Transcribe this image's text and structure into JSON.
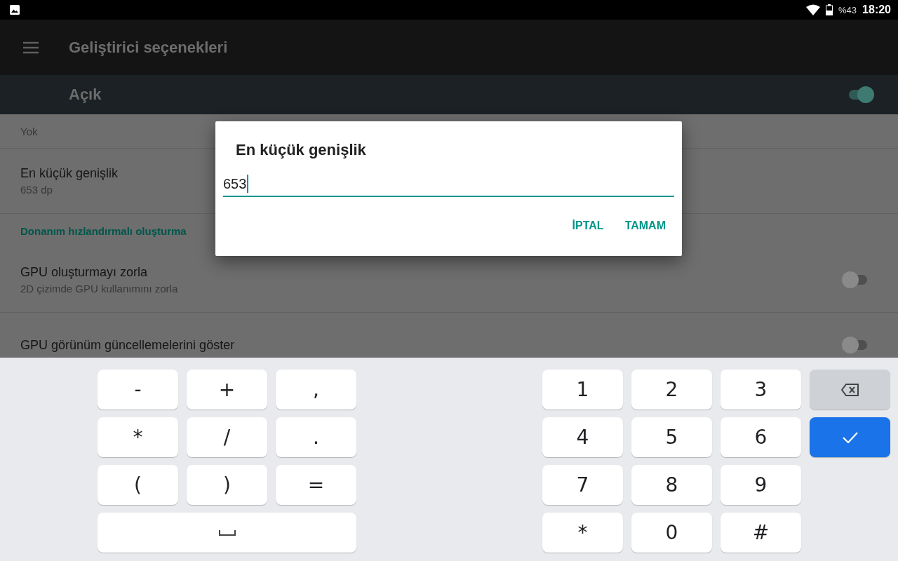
{
  "status_bar": {
    "battery": "%43",
    "time": "18:20"
  },
  "app_bar": {
    "title": "Geliştirici seçenekleri"
  },
  "master_switch": {
    "label": "Açık",
    "on": true
  },
  "settings": [
    {
      "kind": "summary",
      "summary": "Yok"
    },
    {
      "kind": "item",
      "title": "En küçük genişlik",
      "summary": "653 dp"
    },
    {
      "kind": "category",
      "title": "Donanım hızlandırmalı oluşturma"
    },
    {
      "kind": "switch",
      "title": "GPU oluşturmayı zorla",
      "summary": "2D çizimde GPU kullanımını zorla",
      "on": false
    },
    {
      "kind": "switch",
      "title": "GPU görünüm güncellemelerini göster",
      "on": false
    }
  ],
  "dialog": {
    "title": "En küçük genişlik",
    "value": "653",
    "buttons": [
      "İPTAL",
      "TAMAM"
    ]
  },
  "keyboard": {
    "symbol_keys": [
      "-",
      "+",
      ",",
      "*",
      "/",
      ".",
      "(",
      ")",
      "="
    ],
    "number_keys": [
      "1",
      "2",
      "3",
      "4",
      "5",
      "6",
      "7",
      "8",
      "9",
      "*",
      "0",
      "#"
    ]
  }
}
